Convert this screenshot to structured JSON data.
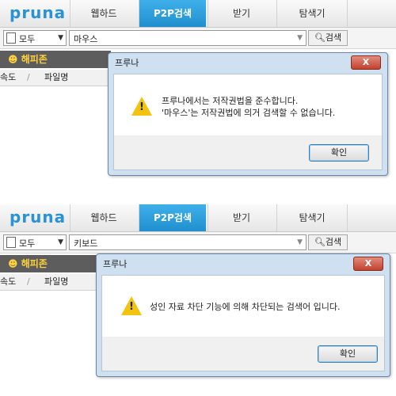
{
  "panels": [
    {
      "logo": "pruna",
      "tabs": [
        "웹하드",
        "P2P검색",
        "받기",
        "탐색기"
      ],
      "active_tab": "P2P검색",
      "search_scope": "모두",
      "search_query": "마우스",
      "search_button": "검색",
      "zone_label": "해피존",
      "columns": [
        "속도",
        "/",
        "파일명"
      ],
      "dialog": {
        "title": "프루나",
        "close_label": "X",
        "message_line1": "프루나에서는 저작권법을 준수합니다.",
        "message_line2": "'마우스'는 저작권법에 의거 검색할 수 없습니다.",
        "ok_label": "확인"
      }
    },
    {
      "logo": "pruna",
      "tabs": [
        "웹하드",
        "P2P검색",
        "받기",
        "탐색기"
      ],
      "active_tab": "P2P검색",
      "search_scope": "모두",
      "search_query": "키보드",
      "search_button": "검색",
      "zone_label": "해피존",
      "columns": [
        "속도",
        "/",
        "파일명"
      ],
      "dialog": {
        "title": "프루나",
        "close_label": "X",
        "message_line1": "성인 자료 차단 기능에 의해 차단되는 검색어 입니다.",
        "ok_label": "확인"
      }
    }
  ],
  "colors": {
    "brand": "#2a92d6",
    "active_tab": "#1f8fcf",
    "zone_text": "#ffd23c",
    "warning": "#f2c40f",
    "close_button": "#c3412e"
  },
  "icons": {
    "logo": "pruna-logo",
    "doc": "document-icon",
    "search": "magnifier-icon",
    "warning": "warning-icon",
    "close": "close-icon",
    "zone": "smiley-icon"
  }
}
